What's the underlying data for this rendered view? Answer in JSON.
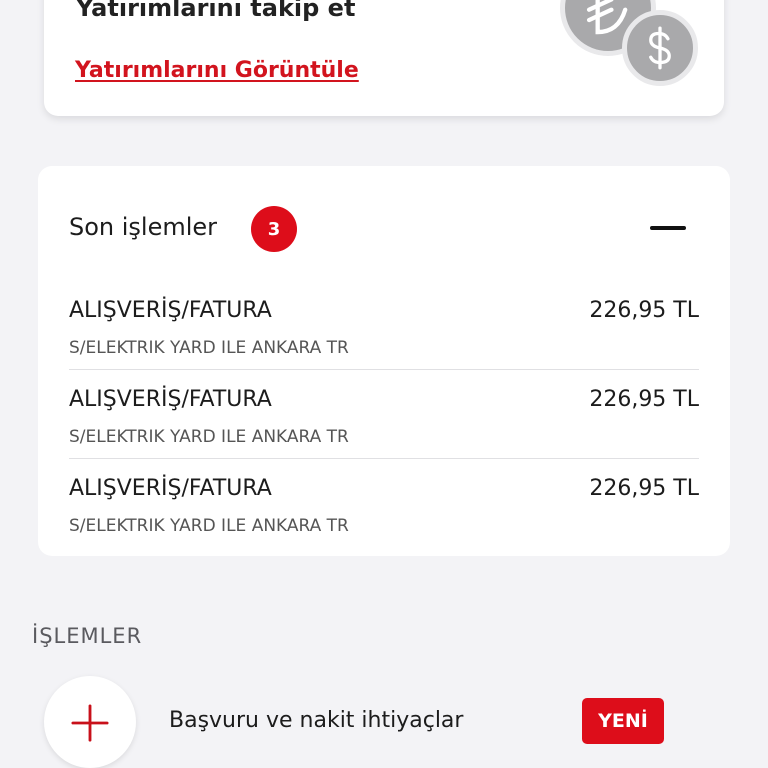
{
  "investments": {
    "title": "Yatırımlarını takip et",
    "link_label": "Yatırımlarını Görüntüle"
  },
  "recent_transactions": {
    "title": "Son işlemler",
    "count": "3",
    "items": [
      {
        "name": "ALIŞVERİŞ/FATURA",
        "description": "S/ELEKTRIK YARD ILE ANKARA TR",
        "amount": "226,95 TL"
      },
      {
        "name": "ALIŞVERİŞ/FATURA",
        "description": "S/ELEKTRIK YARD ILE ANKARA TR",
        "amount": "226,95 TL"
      },
      {
        "name": "ALIŞVERİŞ/FATURA",
        "description": "S/ELEKTRIK YARD ILE ANKARA TR",
        "amount": "226,95 TL"
      }
    ]
  },
  "operations": {
    "heading": "İŞLEMLER",
    "items": [
      {
        "label": "Başvuru ve nakit ihtiyaçlar",
        "badge": "YENİ",
        "icon": "plus-icon"
      }
    ]
  },
  "colors": {
    "accent_red": "#dd0d1a",
    "link_red": "#d2141e",
    "background": "#f3f3f6",
    "coin_gray": "#a9a9ab"
  }
}
